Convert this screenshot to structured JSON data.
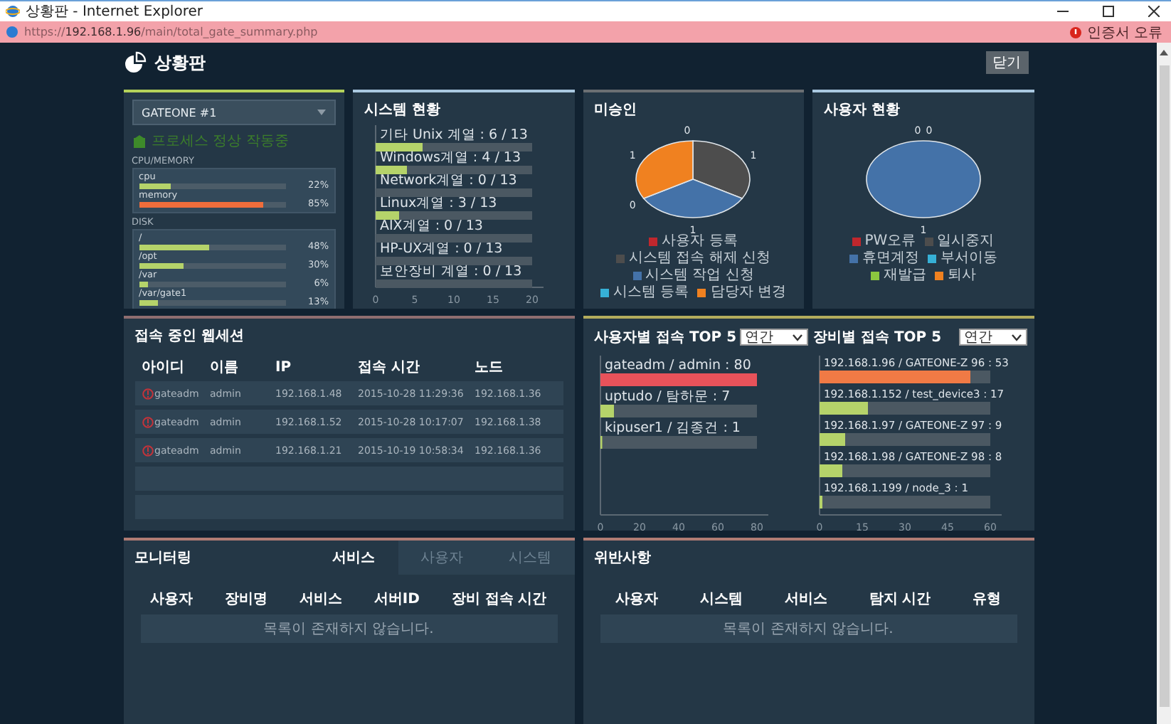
{
  "window": {
    "title": "상황판 - Internet Explorer"
  },
  "address_bar": {
    "url": "https://**192.168.1.96**/main/total_gate_summary.php",
    "certificate_status": "인증서 오류"
  },
  "page": {
    "title": "상황판",
    "close_button": "닫기"
  },
  "server_panel": {
    "server_select": "GATEONE #1",
    "status": "프로세스 정상 작동중",
    "cpu_memory_label": "CPU/MEMORY",
    "cpu_memory": [
      {
        "name": "cpu",
        "reading": "22%",
        "level": 0.22
      },
      {
        "name": "memory",
        "reading": "85%",
        "level": 0.85
      }
    ],
    "disk_label": "DISK",
    "disks": [
      {
        "name": "/",
        "reading": "48%",
        "level": 0.48
      },
      {
        "name": "/opt",
        "reading": "30%",
        "level": 0.3
      },
      {
        "name": "/var",
        "reading": "6%",
        "level": 0.06
      },
      {
        "name": "/var/gate1",
        "reading": "13%",
        "level": 0.13
      }
    ]
  },
  "system_status": {
    "title": "시스템 현황",
    "chart_data": {
      "type": "bar",
      "orientation": "horizontal",
      "categories": [
        "기타 Unix 계열 : 6 / 13",
        "Windows계열 : 4 / 13",
        "Network계열 : 0 / 13",
        "Linux계열 : 3 / 13",
        "AIX계열 : 0 / 13",
        "HP-UX계열 : 0 / 13",
        "보안장비 계열 : 0 / 13"
      ],
      "series": [
        {
          "color": "#b5d36a",
          "values": [
            6,
            4,
            0,
            3,
            0,
            0,
            0
          ]
        },
        {
          "color": "#4b5862",
          "values": [
            14,
            16,
            20,
            17,
            20,
            20,
            20
          ]
        }
      ],
      "stacked": true,
      "xlim": [
        0,
        20
      ],
      "xticks": [
        0,
        5,
        10,
        15,
        20
      ]
    }
  },
  "unapproved": {
    "title": "미승인",
    "chart_data": {
      "type": "pie",
      "categories": [
        "사용자 등록",
        "시스템 접속 해제 신청",
        "시스템 작업 신청",
        "시스템 등록",
        "담당자 변경"
      ],
      "colors": [
        "#c0272d",
        "#4d4d4d",
        "#4472a8",
        "#36b0d6",
        "#f08120"
      ],
      "series": [
        {
          "values": [
            0,
            1,
            1,
            0,
            1
          ]
        }
      ],
      "data_labels": true,
      "value_labels": [
        "0",
        "1",
        "1",
        "0",
        "1"
      ],
      "legend": "bottom"
    }
  },
  "user_status": {
    "title": "사용자 현황",
    "chart_data": {
      "type": "pie",
      "categories": [
        "PW오류",
        "일시중지",
        "휴면계정",
        "부서이동",
        "재발급",
        "퇴사"
      ],
      "colors": [
        "#c0272d",
        "#4d4d4d",
        "#4472a8",
        "#36b0d6",
        "#8cc63f",
        "#f08120"
      ],
      "series": [
        {
          "values": [
            0,
            0,
            1,
            0,
            0,
            0
          ]
        }
      ],
      "data_labels": true,
      "value_labels": [
        "0",
        null,
        "1",
        null,
        null,
        "0"
      ],
      "legend": "bottom"
    }
  },
  "web_sessions": {
    "title": "접속 중인 웹세션",
    "columns": [
      "아이디",
      "이름",
      "IP",
      "접속 시간",
      "노드"
    ],
    "rows": [
      [
        "gateadm",
        "admin",
        "192.168.1.48",
        "2015-10-28 11:29:36",
        "192.168.1.36"
      ],
      [
        "gateadm",
        "admin",
        "192.168.1.52",
        "2015-10-28 10:17:07",
        "192.168.1.38"
      ],
      [
        "gateadm",
        "admin",
        "192.168.1.21",
        "2015-10-19 10:58:34",
        "192.168.1.36"
      ]
    ]
  },
  "user_top5": {
    "title": "사용자별 접속 TOP 5",
    "period": "연간",
    "chart_data": {
      "type": "bar",
      "orientation": "horizontal",
      "categories": [
        "gateadm / admin : 80",
        "uptudo / 탐하문 : 7",
        "kipuser1 / 김종건 : 1"
      ],
      "series": [
        {
          "colors": [
            "#e8525a",
            "#b5d36a",
            "#b5d36a"
          ],
          "values": [
            80,
            7,
            1
          ]
        },
        {
          "color": "#4b5862",
          "values": [
            0,
            73,
            79
          ]
        }
      ],
      "stacked": true,
      "xlim": [
        0,
        80
      ],
      "xticks": [
        0,
        20,
        40,
        60,
        80
      ]
    }
  },
  "device_top5": {
    "title": "장비별 접속 TOP 5",
    "period": "연간",
    "chart_data": {
      "type": "bar",
      "orientation": "horizontal",
      "categories": [
        "192.168.1.96 / GATEONE-Z 96 : 53",
        "192.168.1.152 / test_device3 : 17",
        "192.168.1.97 / GATEONE-Z 97 : 9",
        "192.168.1.98 / GATEONE-Z 98 : 8",
        "192.168.1.199 / node_3 : 1"
      ],
      "series": [
        {
          "colors": [
            "#f07a45",
            "#b5d36a",
            "#b5d36a",
            "#b5d36a",
            "#b5d36a"
          ],
          "values": [
            53,
            17,
            9,
            8,
            1
          ]
        },
        {
          "color": "#4b5862",
          "values": [
            7,
            43,
            51,
            52,
            59
          ]
        }
      ],
      "stacked": true,
      "xlim": [
        0,
        60
      ],
      "xticks": [
        0,
        15,
        30,
        45,
        60
      ]
    }
  },
  "monitoring": {
    "title": "모니터링",
    "tabs": [
      {
        "label": "서비스",
        "selected": true
      },
      {
        "label": "사용자",
        "selected": false
      },
      {
        "label": "시스템",
        "selected": false
      }
    ],
    "columns": [
      "사용자",
      "장비명",
      "서비스",
      "서버ID",
      "장비 접속 시간"
    ],
    "empty_message": "목록이 존재하지 않습니다."
  },
  "violations": {
    "title": "위반사항",
    "columns": [
      "사용자",
      "시스템",
      "서비스",
      "탐지 시간",
      "유형"
    ],
    "empty_message": "목록이 존재하지 않습니다."
  }
}
